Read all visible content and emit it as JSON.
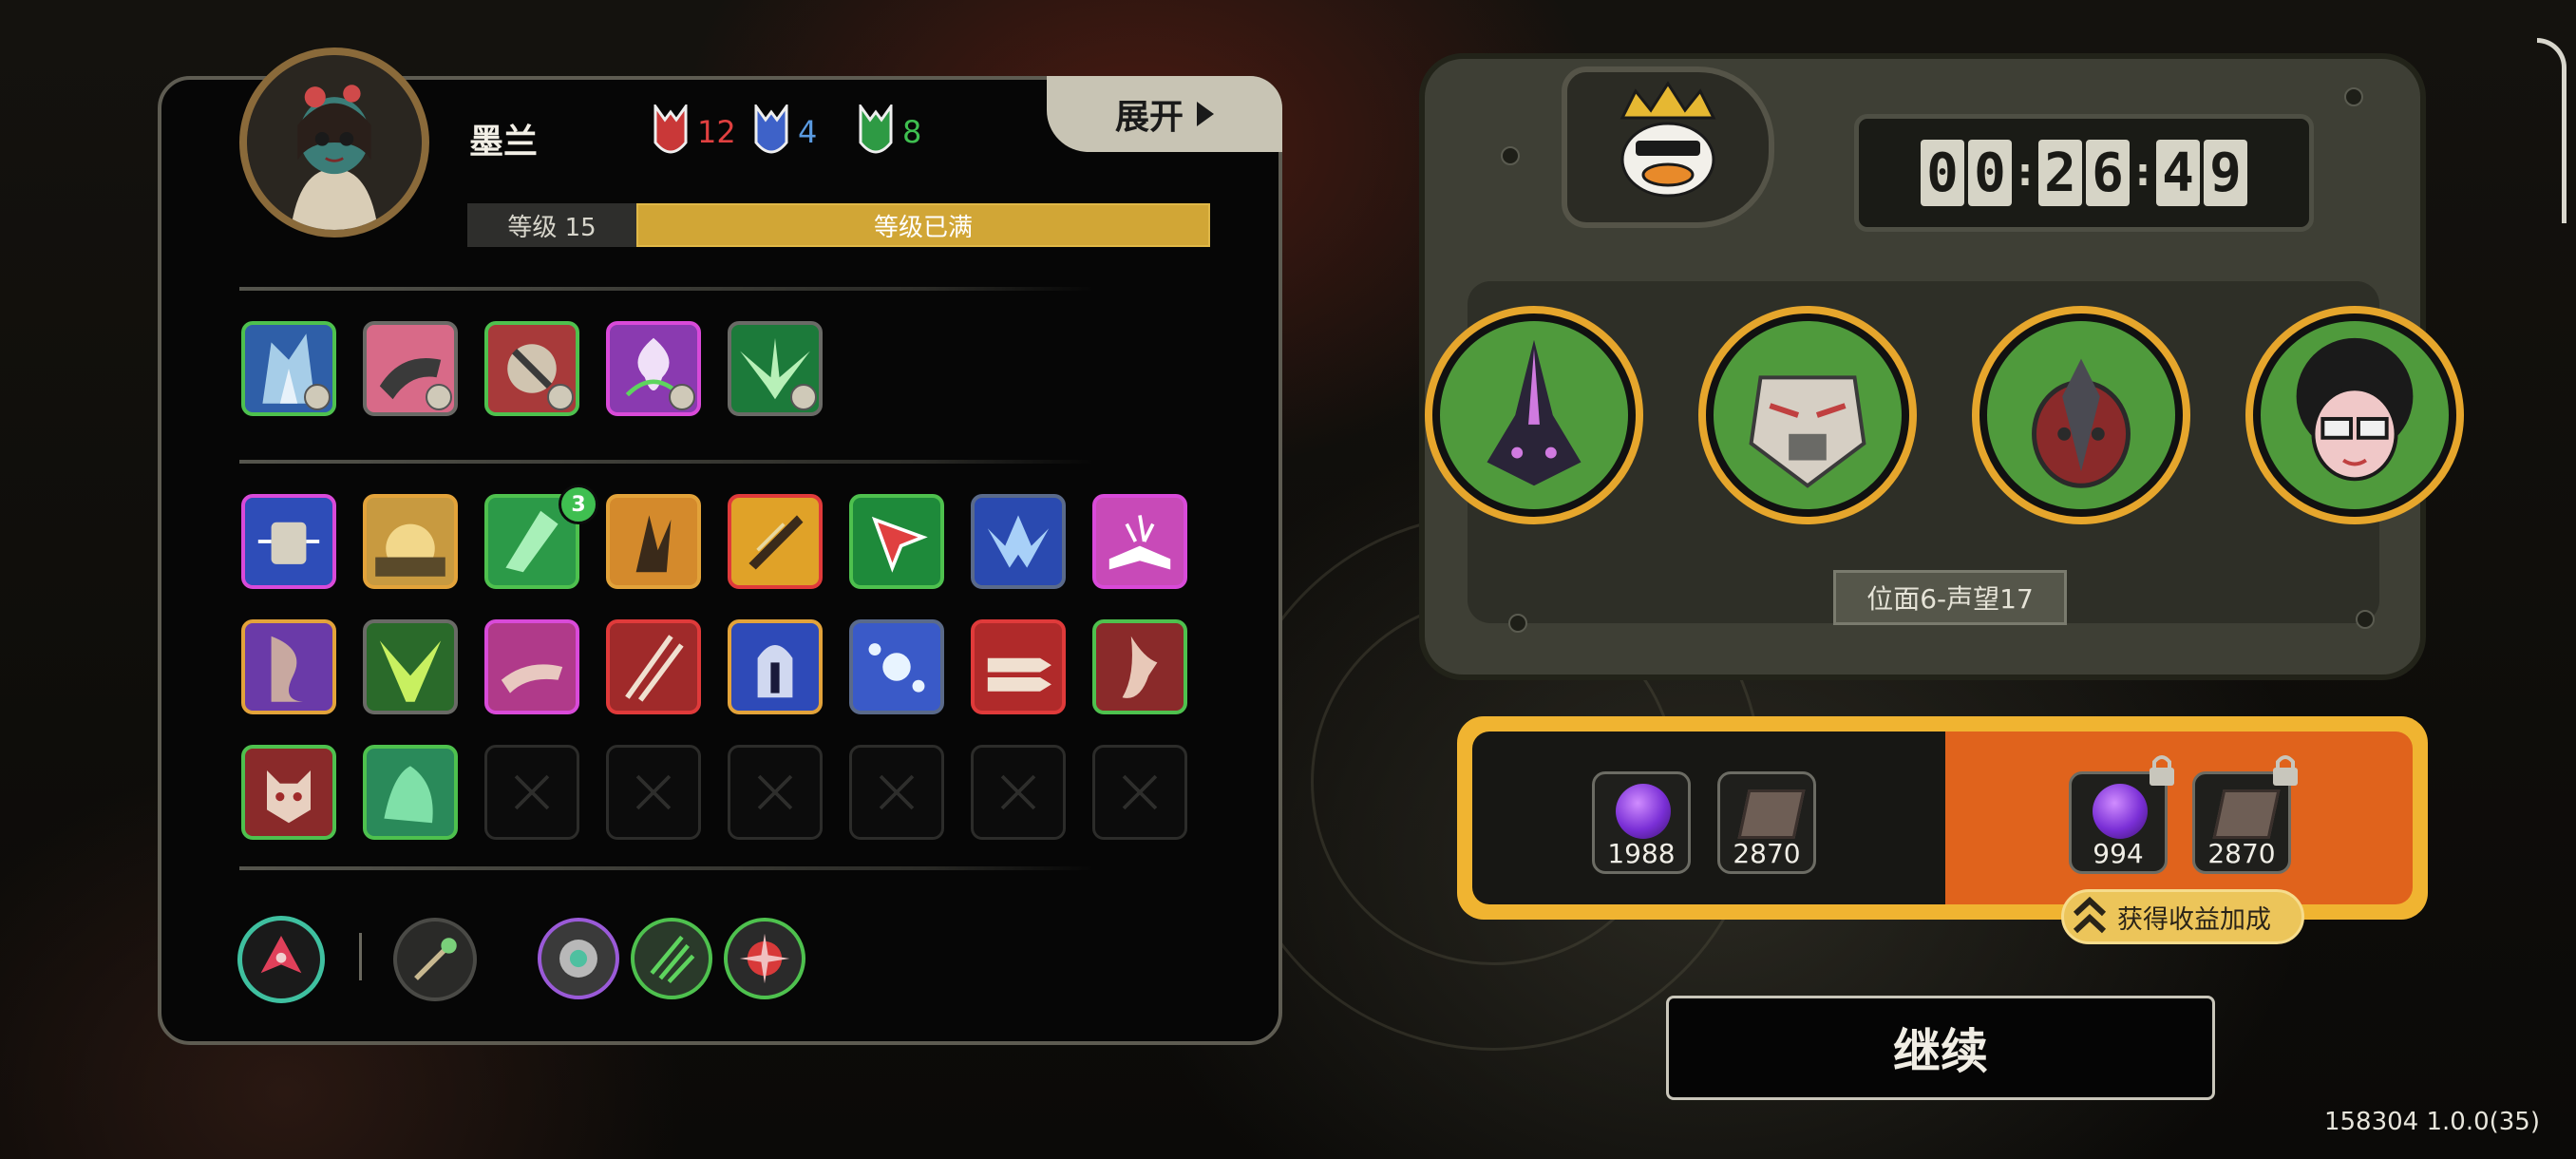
{
  "character": {
    "name": "墨兰",
    "currencies": [
      {
        "name": "red-mask",
        "value": "12",
        "color": "#e04040"
      },
      {
        "name": "blue-mask",
        "value": "4",
        "color": "#5a9ae0"
      },
      {
        "name": "green-mask",
        "value": "8",
        "color": "#3fbf50"
      }
    ],
    "level_label": "等级 15",
    "level_status": "等级已满"
  },
  "expand_button": {
    "label": "展开"
  },
  "skill_badge": "3",
  "timer": {
    "digits": [
      "0",
      "0",
      "2",
      "6",
      "4",
      "9"
    ]
  },
  "stage_label": "位面6-声望17",
  "rewards": {
    "base": [
      {
        "icon": "purple-orb-icon",
        "count": "1988"
      },
      {
        "icon": "book-icon",
        "count": "2870"
      }
    ],
    "bonus": [
      {
        "icon": "purple-orb-icon",
        "count": "994"
      },
      {
        "icon": "book-icon",
        "count": "2870"
      }
    ],
    "bonus_label": "获得收益加成"
  },
  "continue_label": "继续",
  "version": "158304 1.0.0(35)"
}
